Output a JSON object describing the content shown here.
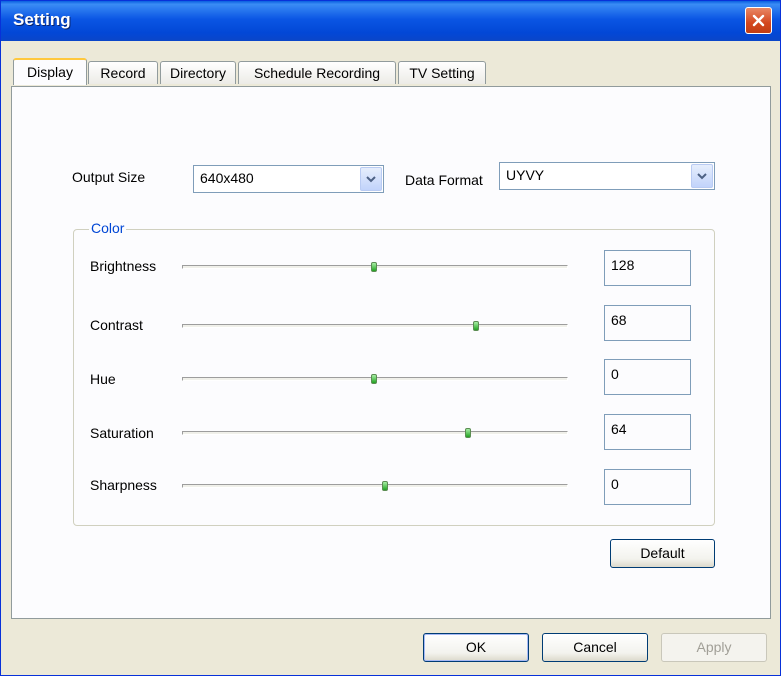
{
  "window": {
    "title": "Setting"
  },
  "tabs": [
    "Display",
    "Record",
    "Directory",
    "Schedule Recording",
    "TV Setting"
  ],
  "display": {
    "output_size_label": "Output Size",
    "output_size_value": "640x480",
    "data_format_label": "Data Format",
    "data_format_value": "UYVY",
    "color_group_label": "Color",
    "sliders": [
      {
        "label": "Brightness",
        "value": "128",
        "fraction": 0.5
      },
      {
        "label": "Contrast",
        "value": "68",
        "fraction": 0.77
      },
      {
        "label": "Hue",
        "value": "0",
        "fraction": 0.5
      },
      {
        "label": "Saturation",
        "value": "64",
        "fraction": 0.75
      },
      {
        "label": "Sharpness",
        "value": "0",
        "fraction": 0.53
      }
    ],
    "default_button": "Default"
  },
  "footer": {
    "ok": "OK",
    "cancel": "Cancel",
    "apply": "Apply"
  },
  "colors": {
    "title_bar": "#0b56e4",
    "group_caption": "#0046d5",
    "slider_thumb": "#21a121"
  },
  "icons": {
    "close": "close-icon",
    "dropdown": "chevron-down-icon"
  }
}
